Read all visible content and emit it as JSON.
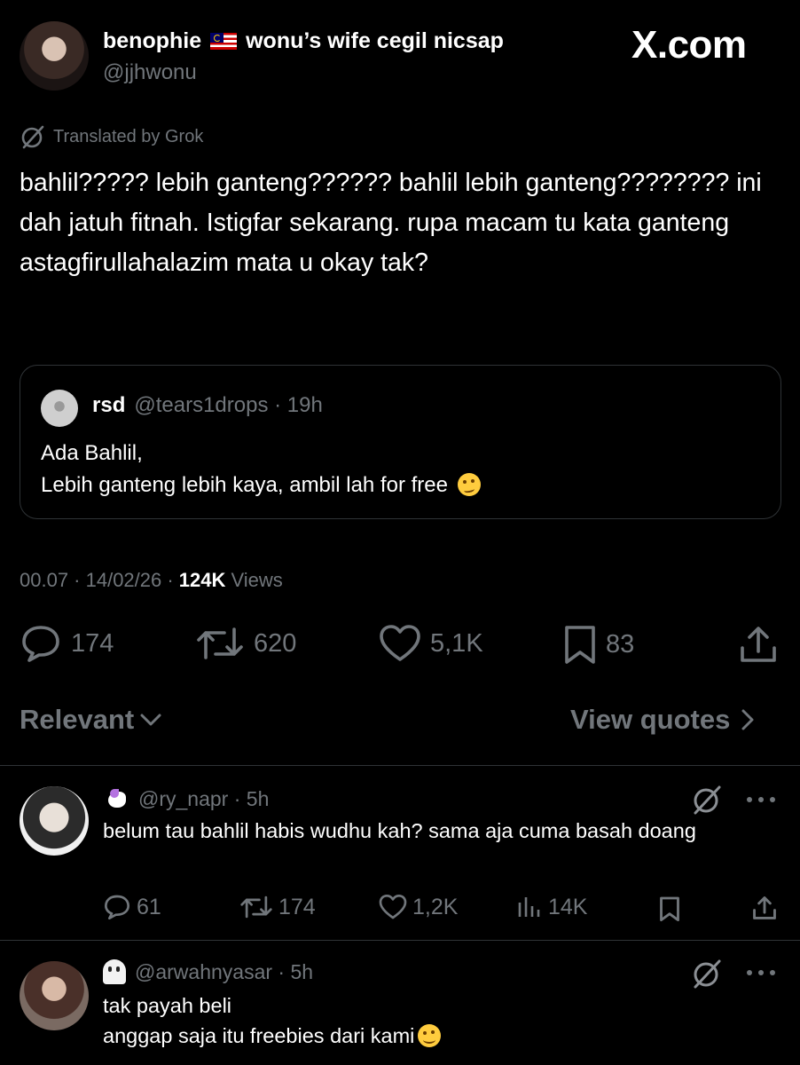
{
  "header": {
    "display_name_prefix": "benophie",
    "display_name_suffix": "wonu’s wife cegil nicsap",
    "flag_icon": "malaysia-flag",
    "handle": "@jjhwonu",
    "site_brand": "X.com"
  },
  "translation": {
    "label": "Translated by Grok"
  },
  "tweet": {
    "text": "bahlil????? lebih ganteng?????? bahlil lebih ganteng???????? ini dah jatuh fitnah. Istigfar sekarang. rupa macam tu kata ganteng astagfirullahalazim mata u okay tak?",
    "timestamp": "00.07 · 14/02/26 · ",
    "views_count": "124K",
    "views_label": " Views"
  },
  "quote": {
    "name": "rsd",
    "handle_time": "@tears1drops · 19h",
    "line1": "Ada Bahlil,",
    "line2": "Lebih ganteng lebih kaya, ambil lah for free",
    "emoji": "woozy-face"
  },
  "actions": {
    "replies": "174",
    "reposts": "620",
    "likes": "5,1K",
    "bookmarks": "83"
  },
  "sort": {
    "label": "Relevant"
  },
  "view_quotes": {
    "label": "View quotes"
  },
  "replies": [
    {
      "emoji": "unicorn",
      "handle_time": "@ry_napr · 5h",
      "text": "belum tau bahlil habis wudhu kah? sama aja cuma basah doang",
      "stats": {
        "replies": "61",
        "reposts": "174",
        "likes": "1,2K",
        "views": "14K"
      }
    },
    {
      "emoji": "ghost",
      "handle_time": "@arwahnyasar · 5h",
      "line1": "tak payah beli",
      "line2": "anggap saja itu freebies dari kami",
      "trailing_emoji": "smiling-face"
    }
  ],
  "colors": {
    "background": "#000000",
    "text": "#e7e9ea",
    "muted": "#71767b",
    "border": "#2f3336"
  }
}
